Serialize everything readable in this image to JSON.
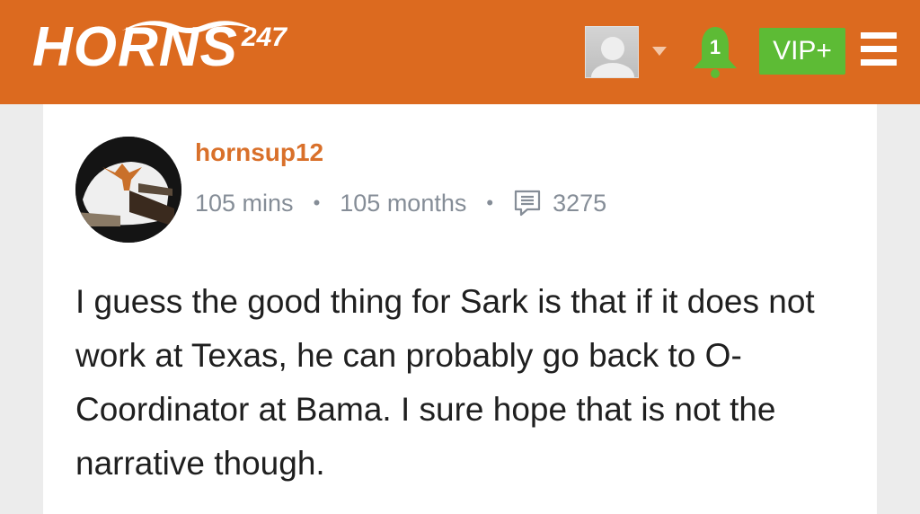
{
  "header": {
    "logo_text": "HORNS",
    "logo_superscript": "247",
    "notification_count": "1",
    "vip_label": "VIP+"
  },
  "post": {
    "username": "hornsup12",
    "time_ago": "105 mins",
    "member_for": "105 months",
    "post_count": "3275",
    "body": "I guess the good thing for Sark is that if it does not work at Texas, he can probably go back to O-Coordinator at Bama. I sure hope that is not the narrative though."
  },
  "colors": {
    "header_bg": "#dc6a1f",
    "username": "#d9702a",
    "vip_bg": "#5dbb35",
    "bell": "#5dbb35"
  },
  "icons": {
    "notifications": "bell-icon",
    "menu": "hamburger-menu-icon",
    "posts": "comment-icon",
    "dropdown": "caret-down-icon"
  }
}
